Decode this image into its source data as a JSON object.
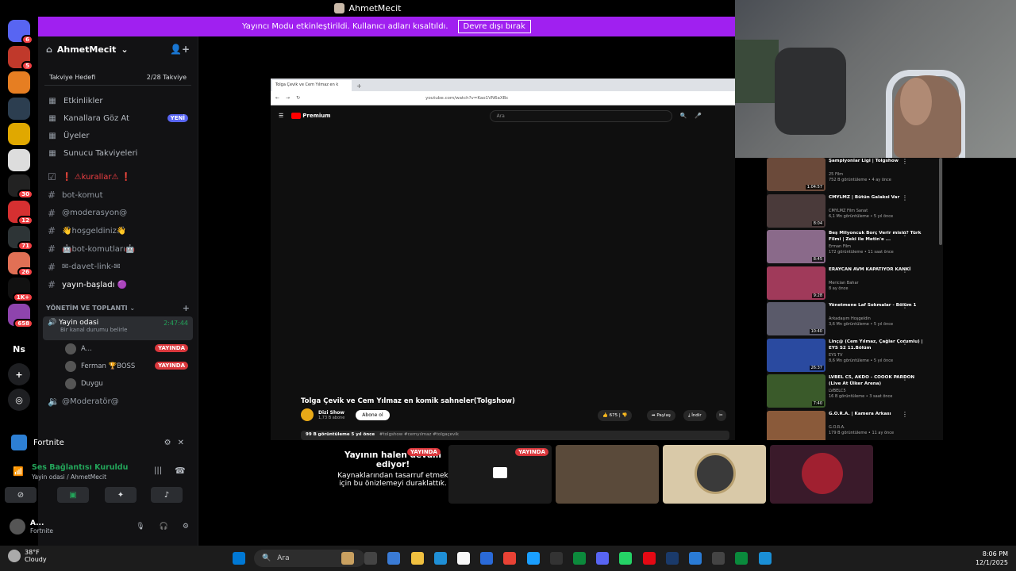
{
  "window": {
    "title": "AhmetMecit"
  },
  "banner": {
    "message": "Yayıncı Modu etkinleştirildi. Kullanıcı adları kısaltıldı.",
    "button": "Devre dışı bırak"
  },
  "server_rail": [
    {
      "icon": "discord-icon",
      "badge": "6",
      "color": "#5865f2"
    },
    {
      "icon": "server-m",
      "badge": "5",
      "color": "#c0392b"
    },
    {
      "icon": "server-1",
      "badge": "",
      "color": "#e67e22"
    },
    {
      "icon": "server-2",
      "badge": "",
      "color": "#2c3e50"
    },
    {
      "icon": "server-3",
      "badge": "",
      "color": "#e0a800"
    },
    {
      "icon": "server-4",
      "badge": "",
      "color": "#ddd"
    },
    {
      "icon": "server-5",
      "badge": "30",
      "color": "#222"
    },
    {
      "icon": "server-6",
      "badge": "12",
      "color": "#d63031"
    },
    {
      "icon": "server-7",
      "badge": "71",
      "color": "#2d3436"
    },
    {
      "icon": "server-8",
      "badge": "26",
      "color": "#e17055"
    },
    {
      "icon": "server-9",
      "badge": "1K+",
      "color": "#111"
    },
    {
      "icon": "server-10",
      "badge": "658",
      "color": "#8e44ad"
    }
  ],
  "rail_ns": "Ns",
  "guild": {
    "name": "AhmetMecit",
    "boost_label": "Takviye Hedefi",
    "boost_count": "2/28 Takviye"
  },
  "nav": [
    {
      "label": "Etkinlikler",
      "icon": "calendar-icon"
    },
    {
      "label": "Kanallara Göz At",
      "icon": "browse-icon",
      "tag": "YENİ"
    },
    {
      "label": "Üyeler",
      "icon": "members-icon"
    },
    {
      "label": "Sunucu Takviyeleri",
      "icon": "boost-icon"
    }
  ],
  "channels": [
    {
      "name": "❗ ⚠kurallar⚠ ❗",
      "icon": "rules"
    },
    {
      "name": "bot-komut",
      "icon": "#"
    },
    {
      "name": "@moderasyon@",
      "icon": "#"
    },
    {
      "name": "👋hoşgeldiniz👋",
      "icon": "#"
    },
    {
      "name": "🤖bot-komutları🤖",
      "icon": "#"
    },
    {
      "name": "✉-davet-link-✉",
      "icon": "#"
    },
    {
      "name": "yayın-başladı 🟣",
      "icon": "#"
    }
  ],
  "category": "YÖNETİM VE TOPLANTI",
  "voice": {
    "name": "Yayin odasi",
    "timer": "2:47:44",
    "status": "Bir kanal durumu belirle",
    "users": [
      {
        "name": "A...",
        "live": "YAYINDA"
      },
      {
        "name": "Ferman 🏆BOSS",
        "live": "YAYINDA"
      },
      {
        "name": "Duygu",
        "live": ""
      }
    ],
    "next_channel": "@Moderatör@"
  },
  "activity": {
    "game": "Fortnite"
  },
  "connection": {
    "status": "Ses Bağlantısı Kuruldu",
    "location": "Yayin odasi / AhmetMecit"
  },
  "user": {
    "name": "A...",
    "activity": "Fortnite"
  },
  "browser": {
    "tab": "Tolga Çevik ve Cem Yılmaz en k",
    "url": "youtube.com/watch?v=Kao1VN6aXBc",
    "yt_brand": "Premium",
    "yt_search": "Ara",
    "video_title": "Tolga Çevik ve Cem Yılmaz en komik sahneler(Tolgshow)",
    "channel": "Dizi Show",
    "subs": "1,73 B abone",
    "subscribe": "Abone ol",
    "likes": "675",
    "share": "Paylaş",
    "download": "İndir",
    "clip": "Klip",
    "views_line": "99 B görüntüleme  5 yıl önce",
    "tags": "#tolgshow #cemyılmaz #tolgaçevik"
  },
  "related": [
    {
      "title": "Şampiyonlar Ligi | Tolgshow",
      "channel": "25 Film",
      "meta": "752 B görüntüleme • 4 ay önce",
      "dur": "1:04:57",
      "color": "#6b4a3a"
    },
    {
      "title": "CMYLMZ | Bütün Galaksi Var",
      "channel": "CMYLMZ Film Sanat",
      "meta": "6,1 Mn görüntüleme • 5 yıl önce",
      "dur": "8:04",
      "color": "#4a3a3a"
    },
    {
      "title": "Beş Milyoncuk Borç Verir misin? Türk Filmi | Zeki ile Metin'e ...",
      "channel": "Erman Film",
      "meta": "172 görüntüleme • 11 saat önce",
      "dur": "8:45",
      "color": "#8a6a8a"
    },
    {
      "title": "ERAYCAN AVM KAPATIYOR KANKİ",
      "channel": "Merician Bahar",
      "meta": "8 ay önce",
      "dur": "9:28",
      "color": "#a03a5a"
    },
    {
      "title": "Yönetmene Laf Sokmalar - Bölüm 1",
      "channel": "Arkadaşım Hoşgeldin",
      "meta": "3,6 Mn görüntüleme • 5 yıl önce",
      "dur": "10:40",
      "color": "#5a5a6a"
    },
    {
      "title": "Linç@ (Cem Yılmaz, Çağlar Çorumlu) | EYS S2 11.Bölüm",
      "channel": "EYS TV",
      "meta": "8,6 Mn görüntüleme • 5 yıl önce",
      "dur": "26:37",
      "color": "#2a4aa0"
    },
    {
      "title": "LVBEL C5, AKDO - COOOK PARDON (Live At Ülker Arena)",
      "channel": "LVBELC5",
      "meta": "16 B görüntüleme • 3 saat önce",
      "dur": "7:40",
      "color": "#3a5a2a"
    },
    {
      "title": "G.O.R.A. | Kamera Arkası",
      "channel": "G.O.R.A.",
      "meta": "179 B görüntüleme • 11 ay önce",
      "dur": "",
      "color": "#8a5a3a"
    }
  ],
  "previews": {
    "message_title": "Yayının halen devam ediyor!",
    "message_body": "Kaynaklarından tasarruf etmek için bu önizlemeyi duraklattık.",
    "live": "YAYINDA"
  },
  "taskbar": {
    "temp": "38°F",
    "weather": "Cloudy",
    "search": "Ara",
    "time": "8:06 PM",
    "date": "12/1/2025"
  }
}
